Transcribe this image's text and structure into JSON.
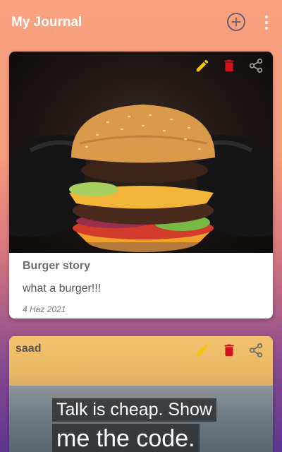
{
  "app": {
    "title": "My Journal"
  },
  "toolbar": {
    "add_icon": "add-circle-icon",
    "more_icon": "more-vert-icon"
  },
  "colors": {
    "edit": "#f4c800",
    "delete": "#d0131c",
    "share": "#6b6b6b"
  },
  "entries": [
    {
      "title": "Burger story",
      "text": "what a burger!!!",
      "date": "4 Haz 2021",
      "image": "burger-photo"
    },
    {
      "title": "saad",
      "image": "sea-quote-photo",
      "quote_line1": "Talk is cheap. Show",
      "quote_line2": "me the code."
    }
  ]
}
